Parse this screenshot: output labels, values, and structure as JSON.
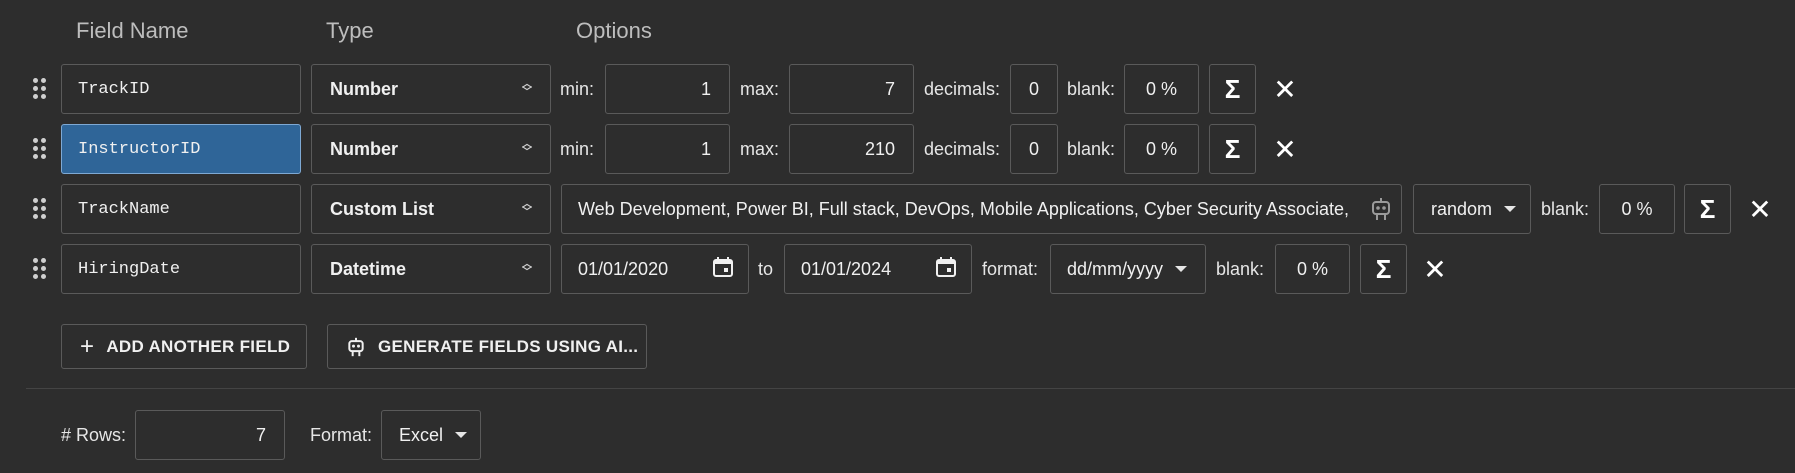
{
  "headers": {
    "field_name": "Field Name",
    "type": "Type",
    "options": "Options"
  },
  "rows": [
    {
      "name": "TrackID",
      "type": "Number",
      "min_label": "min:",
      "min": "1",
      "max_label": "max:",
      "max": "7",
      "decimals_label": "decimals:",
      "decimals": "0",
      "blank_label": "blank:",
      "blank": "0 %"
    },
    {
      "name": "InstructorID",
      "type": "Number",
      "min_label": "min:",
      "min": "1",
      "max_label": "max:",
      "max": "210",
      "decimals_label": "decimals:",
      "decimals": "0",
      "blank_label": "blank:",
      "blank": "0 %"
    },
    {
      "name": "TrackName",
      "type": "Custom List",
      "list": "Web Development, Power BI, Full stack, DevOps, Mobile Applications, Cyber Security Associate, In",
      "order": "random",
      "blank_label": "blank:",
      "blank": "0 %"
    },
    {
      "name": "HiringDate",
      "type": "Datetime",
      "from": "01/01/2020",
      "to_label": "to",
      "to": "01/01/2024",
      "format_label": "format:",
      "format": "dd/mm/yyyy",
      "blank_label": "blank:",
      "blank": "0 %"
    }
  ],
  "actions": {
    "add_field": "ADD ANOTHER FIELD",
    "generate_ai": "GENERATE FIELDS USING AI..."
  },
  "footer": {
    "rows_label": "# Rows:",
    "rows": "7",
    "format_label": "Format:",
    "format": "Excel"
  },
  "icons": {
    "drag": "drag-handle-icon",
    "sigma": "sigma-icon",
    "close": "close-icon",
    "robot": "robot-icon",
    "calendar": "calendar-icon",
    "plus": "plus-icon",
    "caret": "caret-down-icon"
  },
  "colors": {
    "background": "#2d2d2d",
    "selected_field": "#2f6598",
    "border": "#5a5a5a"
  }
}
